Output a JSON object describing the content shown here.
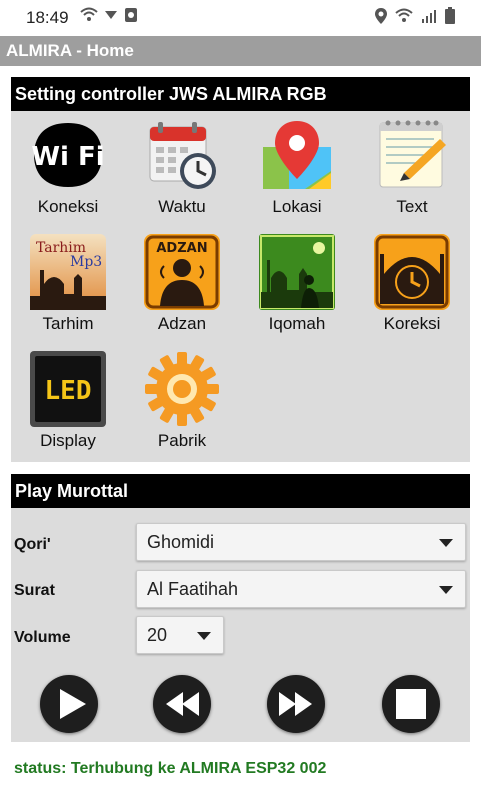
{
  "statusbar": {
    "time": "18:49"
  },
  "app": {
    "title": "ALMIRA - Home"
  },
  "setting": {
    "header": "Setting controller JWS ALMIRA RGB",
    "items": [
      {
        "label": "Koneksi",
        "icon": "wifi-icon"
      },
      {
        "label": "Waktu",
        "icon": "calendar-clock-icon"
      },
      {
        "label": "Lokasi",
        "icon": "map-pin-icon"
      },
      {
        "label": "Text",
        "icon": "notepad-pencil-icon"
      },
      {
        "label": "Tarhim",
        "icon": "mosque-tarhim-icon",
        "icon_text": [
          "Tarhim",
          "Mp3"
        ]
      },
      {
        "label": "Adzan",
        "icon": "adzan-icon",
        "icon_text": "ADZAN"
      },
      {
        "label": "Iqomah",
        "icon": "iqomah-icon"
      },
      {
        "label": "Koreksi",
        "icon": "mosque-clock-icon"
      },
      {
        "label": "Display",
        "icon": "led-display-icon",
        "icon_text": "LED"
      },
      {
        "label": "Pabrik",
        "icon": "gear-icon"
      }
    ]
  },
  "play": {
    "header": "Play Murottal",
    "qori_label": "Qori'",
    "qori_value": "Ghomidi",
    "surat_label": "Surat",
    "surat_value": "Al Faatihah",
    "volume_label": "Volume",
    "volume_value": "20"
  },
  "status": "status: Terhubung ke ALMIRA ESP32 002",
  "colors": {
    "appbar": "#9e9e9e",
    "panel": "#dcdcdc",
    "status_text": "#227a22"
  }
}
